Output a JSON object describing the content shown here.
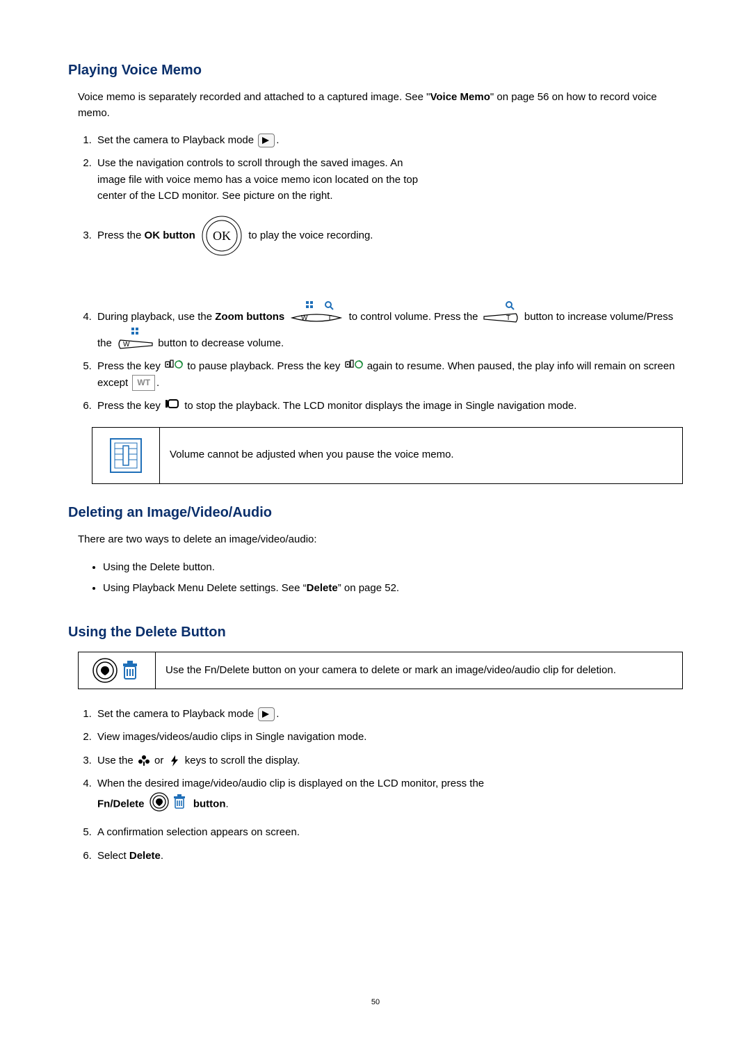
{
  "section1": {
    "heading": "Playing Voice Memo",
    "intro_pre": "Voice memo is separately recorded and attached to a captured image. See \"",
    "intro_bold": "Voice Memo",
    "intro_post": "\" on page 56 on how to record voice memo.",
    "step1": "Set the camera to Playback mode ",
    "step2": "Use the navigation controls to scroll through the saved images. An image file with voice memo has a voice memo icon located on the top center of the LCD monitor. See picture on the right.",
    "step3_pre": "Press the ",
    "step3_bold": "OK button",
    "step3_post": " to play the voice recording.",
    "step4_pre": "During playback, use the ",
    "step4_bold": "Zoom buttons",
    "step4_mid1": " to control volume. Press the ",
    "step4_mid2": " button to increase volume/Press the ",
    "step4_post": " button to decrease volume.",
    "step5_pre": "Press the key ",
    "step5_mid": " to pause playback. Press the key ",
    "step5_mid2": " again to resume. When paused, the play info will remain on screen except ",
    "step5_post": ".",
    "step6_pre": "Press the key ",
    "step6_post": " to stop the playback. The LCD monitor displays the image in Single navigation mode.",
    "note": "Volume cannot be adjusted when you pause the voice memo.",
    "wt": "WT"
  },
  "section2": {
    "heading": "Deleting an Image/Video/Audio",
    "intro": "There are two ways to delete an image/video/audio:",
    "bullet1": "Using the Delete button.",
    "bullet2_pre": "Using Playback Menu Delete settings. See “",
    "bullet2_bold": "Delete",
    "bullet2_post": "” on page 52."
  },
  "section3": {
    "heading": "Using the Delete Button",
    "note": "Use the Fn/Delete button on your camera to delete or mark an image/video/audio clip for deletion.",
    "step1": "Set the camera to Playback mode ",
    "step2": "View images/videos/audio clips in Single navigation mode.",
    "step3_pre": "Use the ",
    "step3_mid": " or ",
    "step3_post": " keys to scroll the display.",
    "step4_pre": "When the desired image/video/audio clip is displayed on the LCD monitor, press the ",
    "step4_bold": "Fn/Delete",
    "step4_bold2": " button",
    "step4_post": ".",
    "step5": "A confirmation selection appears on screen.",
    "step6_pre": "Select ",
    "step6_bold": "Delete",
    "step6_post": "."
  },
  "pagenum": "50"
}
